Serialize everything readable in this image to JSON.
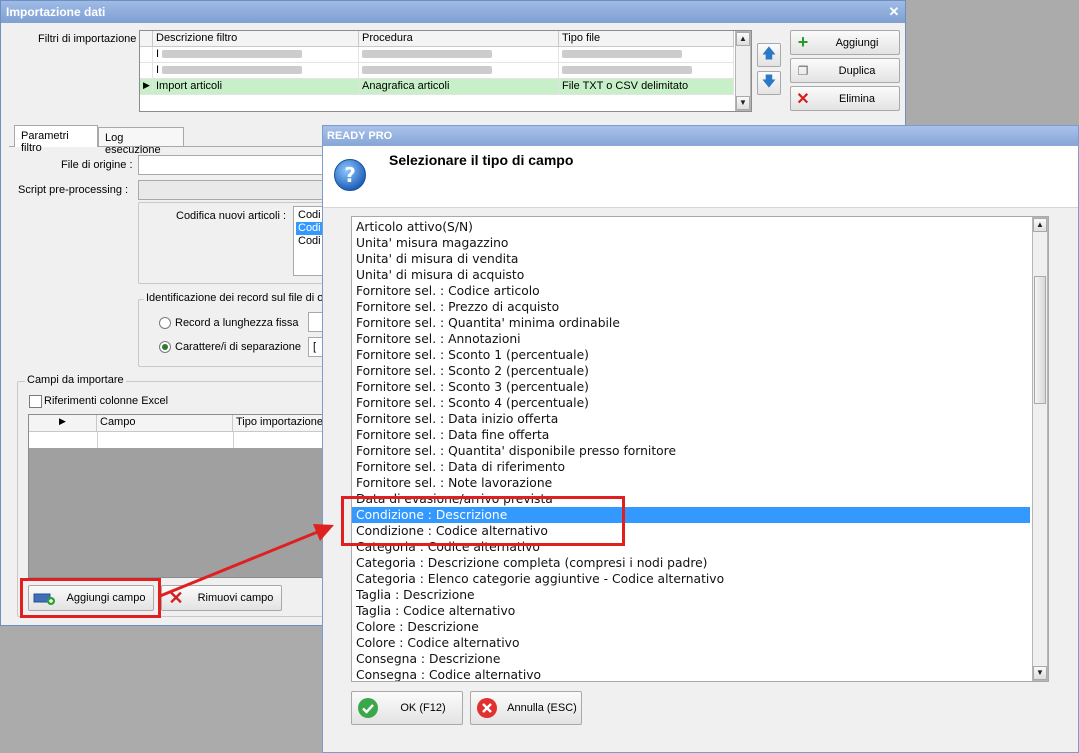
{
  "main_window": {
    "title": "Importazione dati",
    "filters_label": "Filtri di importazione :",
    "filters_table": {
      "columns": [
        "Descrizione filtro",
        "Procedura",
        "Tipo file"
      ],
      "visible_rows": [
        {
          "marker": "",
          "descrizione": "I",
          "procedura": "",
          "tipo_file": ""
        },
        {
          "marker": "",
          "descrizione": "I",
          "procedura": "",
          "tipo_file": ""
        },
        {
          "marker": "▶",
          "descrizione": "Import articoli",
          "procedura": "Anagrafica articoli",
          "tipo_file": "File TXT o CSV delimitato"
        }
      ]
    },
    "buttons": {
      "aggiungi": "Aggiungi",
      "duplica": "Duplica",
      "elimina": "Elimina"
    },
    "tabs": [
      "Parametri filtro",
      "Log esecuzione"
    ],
    "file_origine_label": "File di origine :",
    "script_label": "Script pre-processing :",
    "codifica_label": "Codifica nuovi articoli :",
    "codifica_options": [
      "Codi",
      "Codi",
      "Codi"
    ],
    "identificazione_label": "Identificazione dei record sul file di or",
    "radio_lunghezza": "Record a lunghezza fissa",
    "radio_separazione": "Carattere/i di separazione",
    "separatore_value": "[",
    "campi_group_label": "Campi da importare",
    "riferimenti_label": "Riferimenti colonne Excel",
    "campi_columns": [
      "Campo",
      "Tipo importazione"
    ],
    "aggiungi_campo": "Aggiungi campo",
    "rimuovi_campo": "Rimuovi campo"
  },
  "dialog": {
    "title": "READY PRO",
    "prompt": "Selezionare il tipo di campo",
    "items": [
      "Articolo attivo(S/N)",
      "Unita' misura magazzino",
      "Unita' di misura di vendita",
      "Unita' di misura di acquisto",
      "Fornitore sel. : Codice articolo",
      "Fornitore sel. : Prezzo di acquisto",
      "Fornitore sel. : Quantita' minima ordinabile",
      "Fornitore sel. : Annotazioni",
      "Fornitore sel. : Sconto 1 (percentuale)",
      "Fornitore sel. : Sconto 2 (percentuale)",
      "Fornitore sel. : Sconto 3 (percentuale)",
      "Fornitore sel. : Sconto 4 (percentuale)",
      "Fornitore sel. : Data inizio offerta",
      "Fornitore sel. : Data fine offerta",
      "Fornitore sel. : Quantita' disponibile presso fornitore",
      "Fornitore sel. : Data di riferimento",
      "Fornitore sel. : Note lavorazione",
      "Data di evasione/arrivo prevista",
      "Condizione : Descrizione",
      "Condizione : Codice alternativo",
      "Categoria : Codice alternativo",
      "Categoria : Descrizione completa (compresi i nodi padre)",
      "Categoria : Elenco categorie aggiuntive - Codice alternativo",
      "Taglia : Descrizione",
      "Taglia : Codice alternativo",
      "Colore : Descrizione",
      "Colore : Codice alternativo",
      "Consegna : Descrizione",
      "Consegna : Codice alternativo"
    ],
    "selected_index": 18,
    "ok_label": "OK (F12)",
    "cancel_label": "Annulla (ESC)"
  },
  "annotation_color": "#e02020"
}
